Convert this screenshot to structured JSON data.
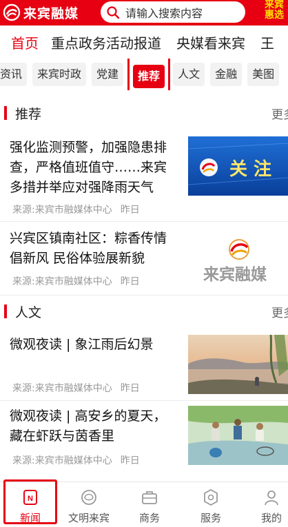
{
  "header": {
    "logo_text": "来宾融媒",
    "search_placeholder": "请输入搜索内容",
    "promo_lines": [
      "来宾",
      "惠选"
    ]
  },
  "main_nav": [
    "首页",
    "重点政务活动报道",
    "央媒看来宾",
    "王"
  ],
  "sub_tabs": [
    "资讯",
    "来宾时政",
    "党建",
    "推荐",
    "人文",
    "金融",
    "美图"
  ],
  "active_sub_tab": "推荐",
  "sections": [
    {
      "title": "推荐",
      "more": "更多",
      "articles": [
        {
          "title": "强化监测预警，加强隐患排查，严格值班值守……来宾多措并举应对强降雨天气",
          "source": "来源:来宾市融媒体中心",
          "time": "昨日",
          "thumb_text": "关 注"
        },
        {
          "title": "兴宾区镇南社区：粽香传情倡新风 民俗体验展新貌",
          "source": "来源:来宾市融媒体中心",
          "time": "昨日",
          "thumb_text": "来宾融媒"
        }
      ]
    },
    {
      "title": "人文",
      "more": "更多",
      "articles": [
        {
          "title": "微观夜读 | 象江雨后幻景",
          "source": "来源:来宾市融媒体中心",
          "time": "昨日"
        },
        {
          "title": "微观夜读 | 高安乡的夏天，藏在虾跃与茵香里",
          "source": "来源:来宾市融媒体中心",
          "time": "昨日"
        }
      ]
    }
  ],
  "bottom_tabs": [
    "新闻",
    "文明来宾",
    "商务",
    "服务",
    "我的"
  ],
  "colors": {
    "brand_red": "#e60012",
    "promo_yellow": "#ffe100"
  }
}
